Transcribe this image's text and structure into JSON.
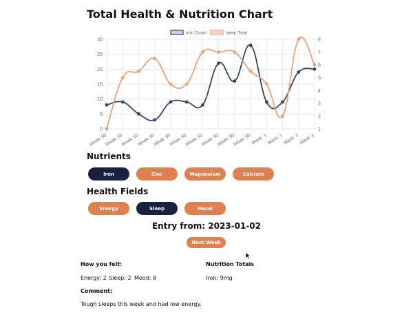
{
  "page": {
    "title": "Total Health & Nutrition Chart"
  },
  "chart_data": {
    "type": "line",
    "categories": [
      "Week: 50",
      "Week: 50",
      "Week: 50",
      "Week: 50",
      "Week: 50",
      "Week: 50",
      "Week: 50",
      "Week: 50",
      "Week: 50",
      "Week: 50",
      "Week: 1",
      "Week: 1",
      "Week: 1",
      "Week: 1"
    ],
    "series": [
      {
        "name": "Iron Count",
        "axis": "left",
        "color": "#34446a",
        "values": [
          8,
          9,
          5,
          3,
          9,
          9,
          8,
          22,
          16,
          28,
          9,
          9,
          19,
          20
        ]
      },
      {
        "name": "sleep Total",
        "axis": "right",
        "color": "#e9a27a",
        "values": [
          1,
          5,
          5.5,
          6.5,
          4.5,
          4.5,
          7,
          7,
          7,
          5.5,
          4.5,
          2,
          8,
          6
        ]
      }
    ],
    "y_left": {
      "min": 0,
      "max": 30,
      "ticks": [
        0,
        5,
        10,
        15,
        20,
        25,
        30
      ]
    },
    "y_right": {
      "min": 1,
      "max": 8,
      "ticks": [
        1,
        2,
        3,
        4,
        5,
        6,
        7,
        8
      ]
    },
    "legend_position": "top",
    "grid": true
  },
  "nutrients": {
    "title": "Nutrients",
    "items": [
      {
        "label": "Iron",
        "active": true
      },
      {
        "label": "Zinc",
        "active": false
      },
      {
        "label": "Magnesium",
        "active": false
      },
      {
        "label": "Calcium",
        "active": false
      }
    ]
  },
  "health_fields": {
    "title": "Health Fields",
    "items": [
      {
        "label": "Energy",
        "active": false
      },
      {
        "label": "Sleep",
        "active": true
      },
      {
        "label": "Mood",
        "active": false
      }
    ]
  },
  "entry": {
    "title": "Entry from: 2023-01-02",
    "next_label": "Next Week",
    "felt_label": "How you felt:",
    "energy": "Energy: 2",
    "sleep": "Sleep: 2",
    "mood": "Mood: 8",
    "comment_label": "Comment:",
    "comment": "Tough sleeps this week and had low energy.",
    "nutrition_label": "Nutrition Totals",
    "nutrition_value": "Iron: 9mg"
  },
  "colors": {
    "accent": "#e07f4f",
    "navy": "#16223f"
  }
}
